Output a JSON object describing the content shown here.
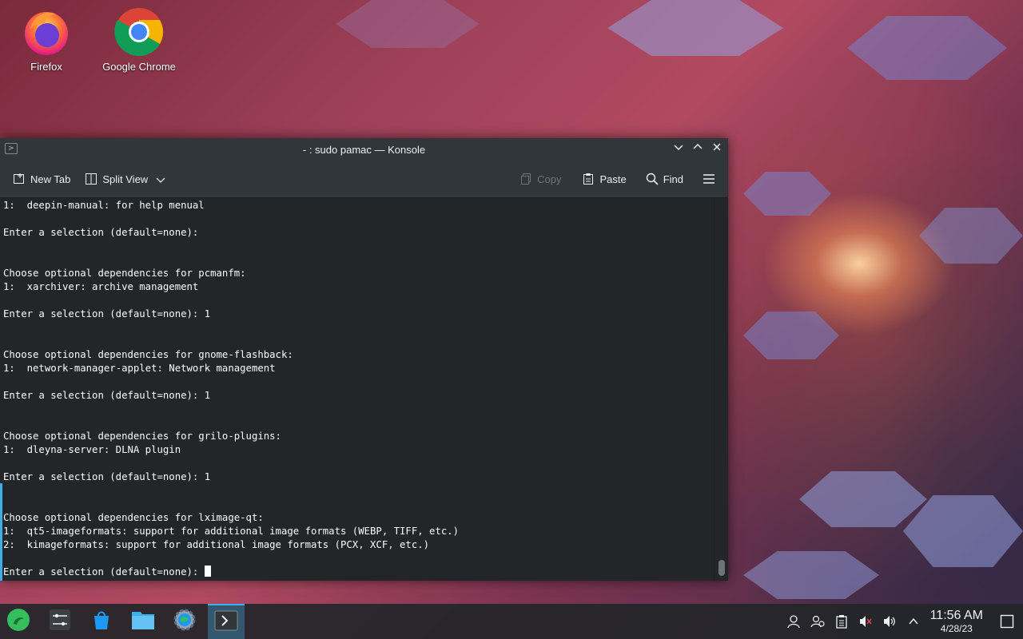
{
  "desktop": {
    "icons": [
      {
        "label": "Firefox",
        "icon": "firefox-icon"
      },
      {
        "label": "Google Chrome",
        "icon": "chrome-icon"
      }
    ]
  },
  "window": {
    "title": "- : sudo pamac — Konsole",
    "toolbar": {
      "new_tab": "New Tab",
      "split_view": "Split View",
      "copy": "Copy",
      "paste": "Paste",
      "find": "Find"
    },
    "terminal_lines": [
      "1:  deepin-manual: for help menual",
      "",
      "Enter a selection (default=none):",
      "",
      "",
      "Choose optional dependencies for pcmanfm:",
      "1:  xarchiver: archive management",
      "",
      "Enter a selection (default=none): 1",
      "",
      "",
      "Choose optional dependencies for gnome-flashback:",
      "1:  network-manager-applet: Network management",
      "",
      "Enter a selection (default=none): 1",
      "",
      "",
      "Choose optional dependencies for grilo-plugins:",
      "1:  dleyna-server: DLNA plugin",
      "",
      "Enter a selection (default=none): 1",
      "",
      "",
      "Choose optional dependencies for lximage-qt:",
      "1:  qt5-imageformats: support for additional image formats (WEBP, TIFF, etc.)",
      "2:  kimageformats: support for additional image formats (PCX, XCF, etc.)",
      ""
    ],
    "prompt": "Enter a selection (default=none): "
  },
  "taskbar": {
    "items": [
      {
        "icon": "manjaro-menu-icon"
      },
      {
        "icon": "settings-sliders-icon"
      },
      {
        "icon": "software-store-icon"
      },
      {
        "icon": "file-manager-icon"
      },
      {
        "icon": "system-settings-icon"
      },
      {
        "icon": "konsole-icon",
        "active": true
      }
    ],
    "clock": {
      "time": "11:56 AM",
      "date": "4/28/23"
    }
  },
  "colors": {
    "accent": "#3daee9",
    "terminal_bg": "#232629",
    "titlebar_bg": "#31363b"
  }
}
